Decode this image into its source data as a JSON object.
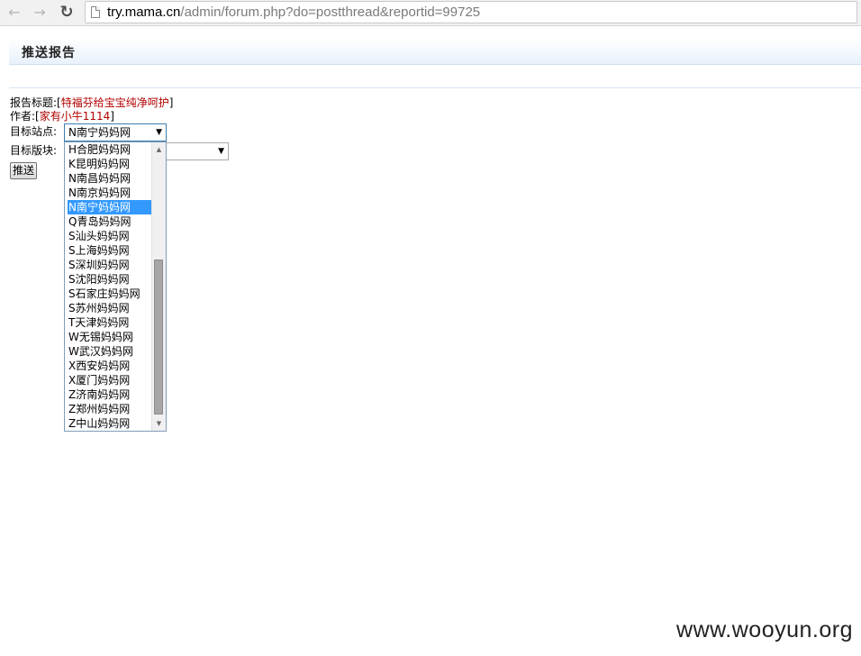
{
  "browser": {
    "back_icon": "←",
    "forward_icon": "→",
    "reload_icon": "↻",
    "url_host": "try.mama.cn",
    "url_path": "/admin/forum.php?do=postthread&reportid=99725"
  },
  "header": {
    "title": "推送报告"
  },
  "form": {
    "report_title_label": "报告标题:",
    "report_title_value": "特福芬给宝宝纯净呵护",
    "author_label": "作者:",
    "author_value": "家有小牛1114",
    "target_site_label": "目标站点:",
    "target_site_value": "N南宁妈妈网",
    "target_board_label": "目标版块:",
    "target_board_value": "",
    "submit_label": "推送"
  },
  "dropdown": {
    "selected": "N南宁妈妈网",
    "options": [
      "H合肥妈妈网",
      "K昆明妈妈网",
      "N南昌妈妈网",
      "N南京妈妈网",
      "N南宁妈妈网",
      "Q青岛妈妈网",
      "S汕头妈妈网",
      "S上海妈妈网",
      "S深圳妈妈网",
      "S沈阳妈妈网",
      "S石家庄妈妈网",
      "S苏州妈妈网",
      "T天津妈妈网",
      "W无锡妈妈网",
      "W武汉妈妈网",
      "X西安妈妈网",
      "X厦门妈妈网",
      "Z济南妈妈网",
      "Z郑州妈妈网",
      "Z中山妈妈网"
    ]
  },
  "watermark": "www.wooyun.org"
}
